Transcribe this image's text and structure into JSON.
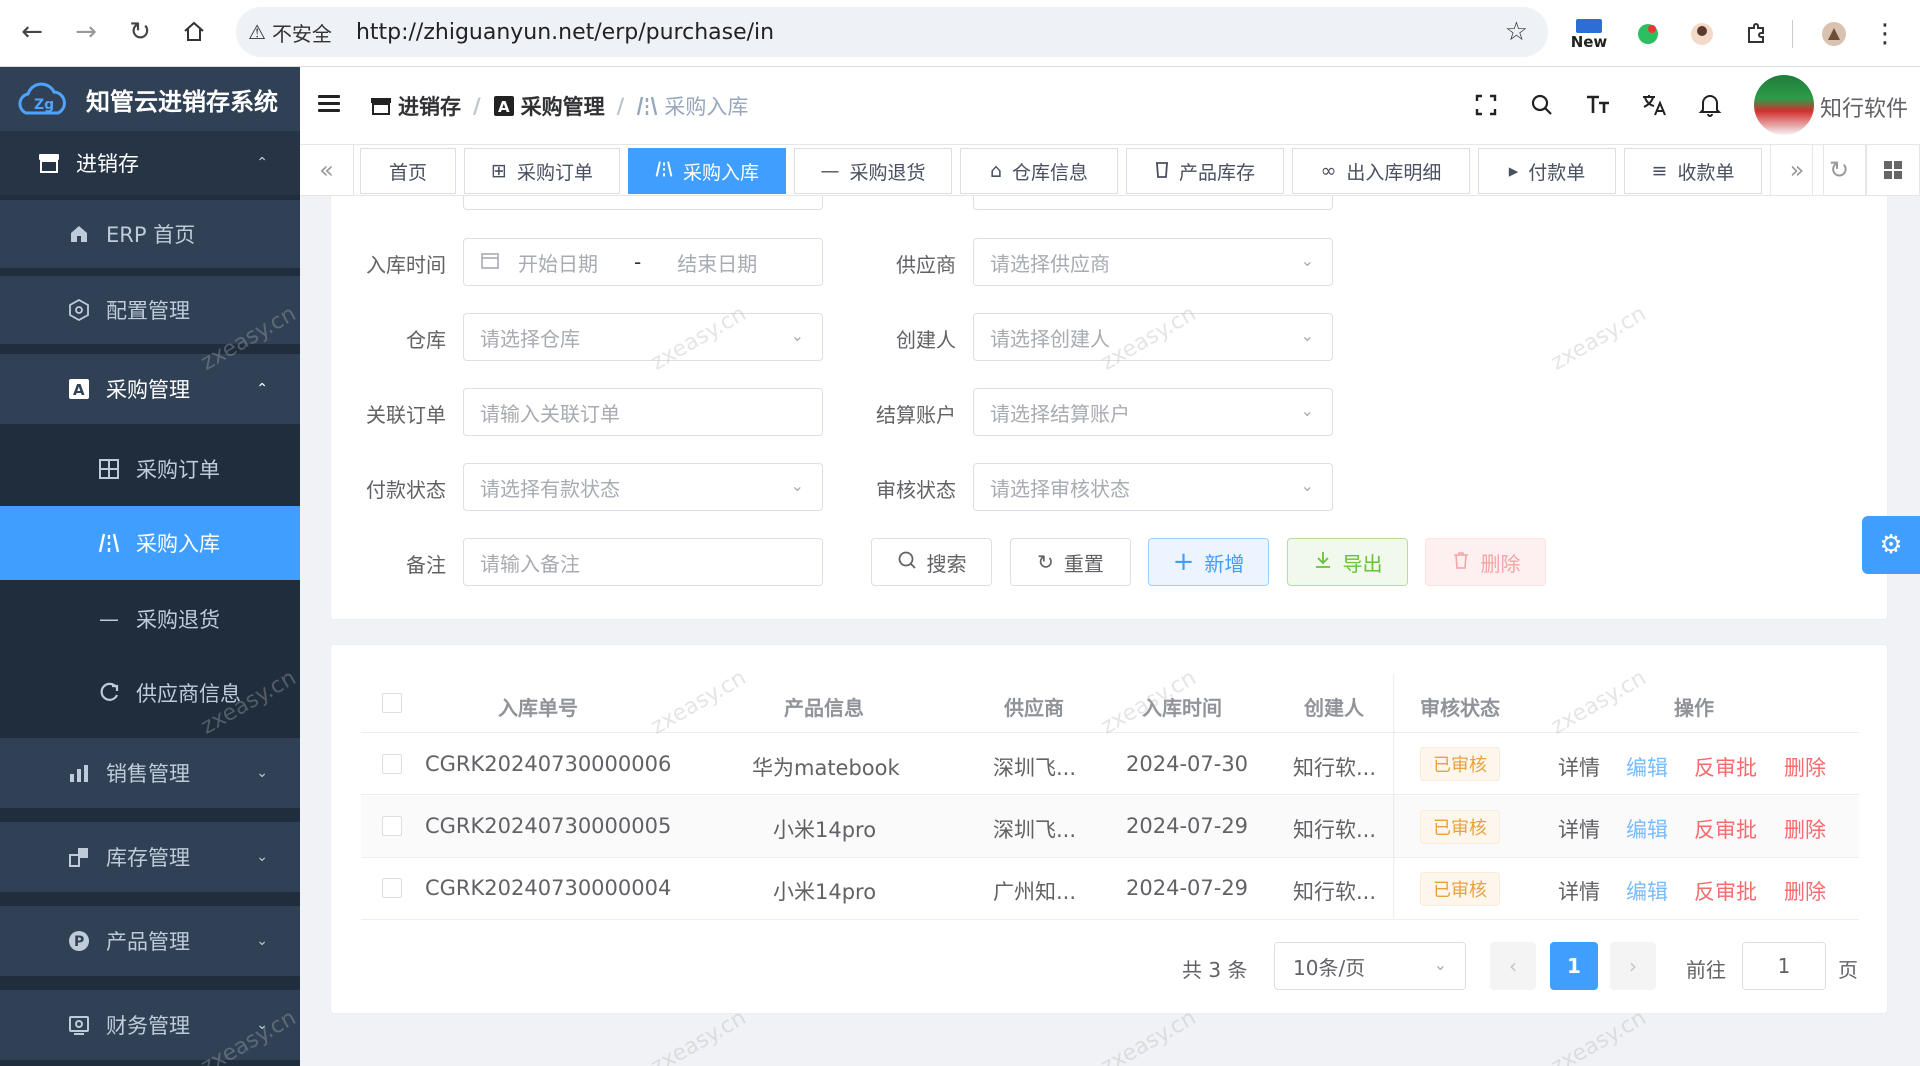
{
  "browser": {
    "security_label": "不安全",
    "url": "http://zhiguanyun.net/erp/purchase/in",
    "ext_new_label": "New"
  },
  "sidebar": {
    "app_title": "知管云进销存系统",
    "items": [
      {
        "label": "进销存"
      },
      {
        "label": "ERP 首页"
      },
      {
        "label": "配置管理"
      },
      {
        "label": "采购管理"
      },
      {
        "label": "采购订单"
      },
      {
        "label": "采购入库"
      },
      {
        "label": "采购退货"
      },
      {
        "label": "供应商信息"
      },
      {
        "label": "销售管理"
      },
      {
        "label": "库存管理"
      },
      {
        "label": "产品管理"
      },
      {
        "label": "财务管理"
      }
    ]
  },
  "header": {
    "breadcrumbs": [
      "进销存",
      "采购管理",
      "采购入库"
    ],
    "user_name": "知行软件"
  },
  "tabs": [
    "首页",
    "采购订单",
    "采购入库",
    "采购退货",
    "仓库信息",
    "产品库存",
    "出入库明细",
    "付款单",
    "收款单"
  ],
  "search": {
    "labels": {
      "in_time": "入库时间",
      "supplier": "供应商",
      "warehouse": "仓库",
      "creator": "创建人",
      "order": "关联订单",
      "account": "结算账户",
      "pay_status": "付款状态",
      "audit_status": "审核状态",
      "remark": "备注"
    },
    "placeholders": {
      "start_date": "开始日期",
      "date_sep": "-",
      "end_date": "结束日期",
      "supplier": "请选择供应商",
      "warehouse": "请选择仓库",
      "creator": "请选择创建人",
      "order": "请输入关联订单",
      "account": "请选择结算账户",
      "pay_status": "请选择有款状态",
      "audit_status": "请选择审核状态",
      "remark": "请输入备注"
    },
    "buttons": {
      "search": "搜索",
      "reset": "重置",
      "add": "新增",
      "export": "导出",
      "delete": "删除"
    }
  },
  "table": {
    "columns": [
      "入库单号",
      "产品信息",
      "供应商",
      "入库时间",
      "创建人",
      "审核状态",
      "操作"
    ],
    "rows": [
      {
        "no": "CGRK20240730000006",
        "product": "华为matebook",
        "supplier": "深圳飞...",
        "time": "2024-07-30",
        "creator": "知行软...",
        "status": "已审核"
      },
      {
        "no": "CGRK20240730000005",
        "product": "小米14pro",
        "supplier": "深圳飞...",
        "time": "2024-07-29",
        "creator": "知行软...",
        "status": "已审核"
      },
      {
        "no": "CGRK20240730000004",
        "product": "小米14pro",
        "supplier": "广州知...",
        "time": "2024-07-29",
        "creator": "知行软...",
        "status": "已审核"
      }
    ],
    "actions": {
      "detail": "详情",
      "edit": "编辑",
      "unaudit": "反审批",
      "delete": "删除"
    }
  },
  "pagination": {
    "total": "共 3 条",
    "page_size": "10条/页",
    "current_page": "1",
    "goto_prefix": "前往",
    "goto_value": "1",
    "goto_suffix": "页"
  },
  "watermark": "zxeasy.cn",
  "colors": {
    "primary": "#409eff",
    "sidebar": "#304156",
    "warning": "#e6a23c",
    "danger": "#f56c6c",
    "success": "#67c23a"
  }
}
